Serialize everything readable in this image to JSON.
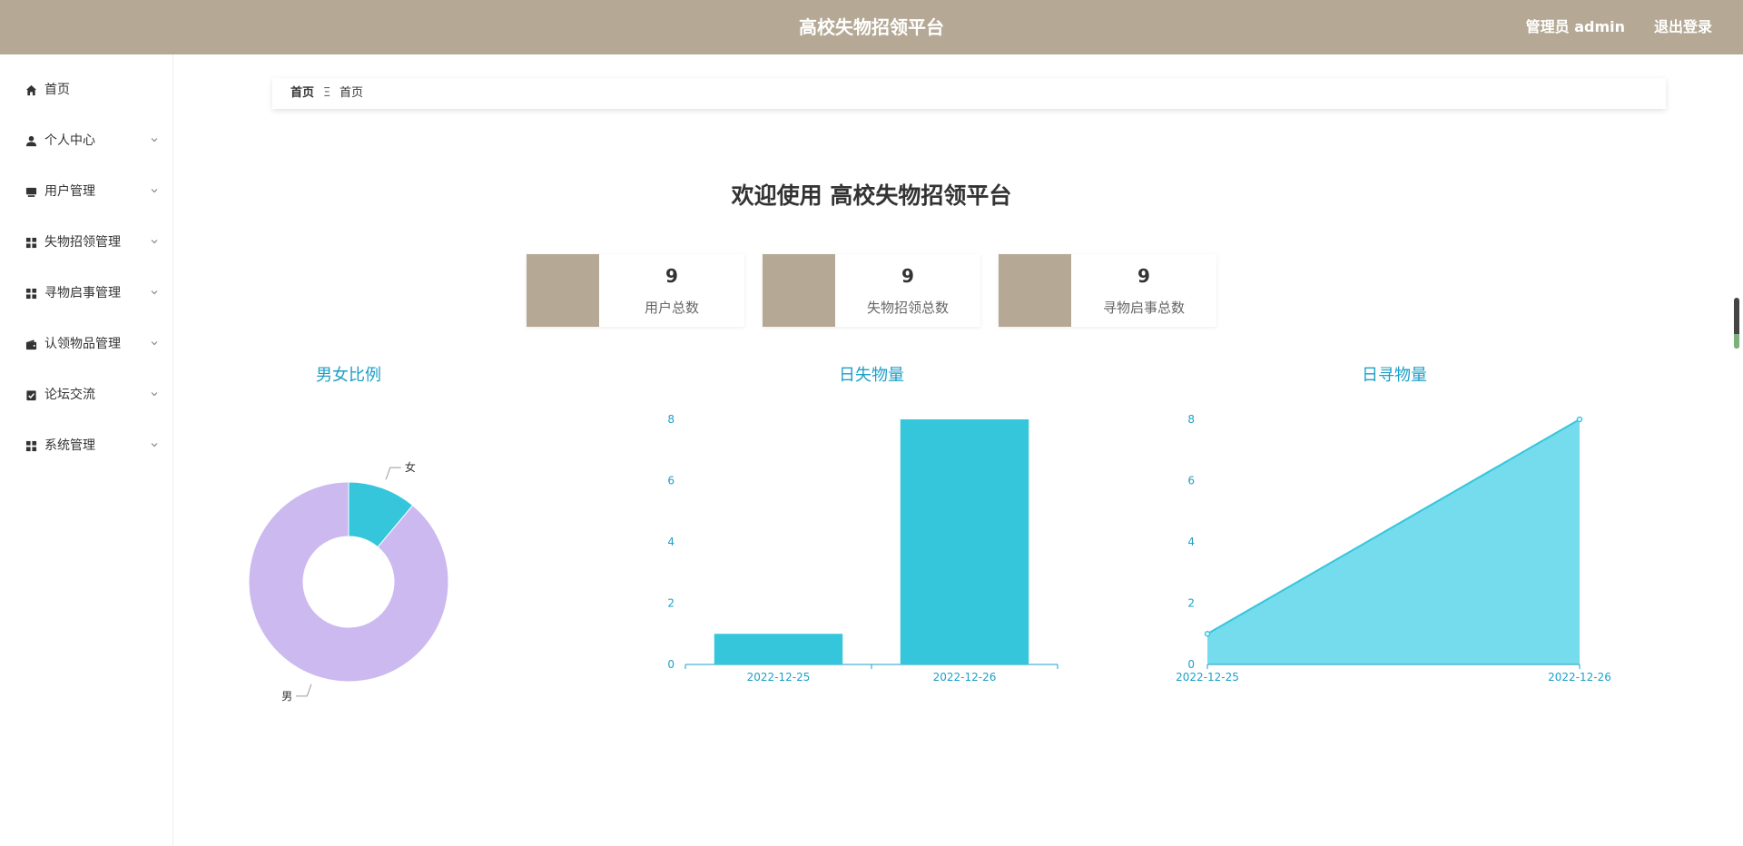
{
  "header": {
    "title": "高校失物招领平台",
    "user": "管理员 admin",
    "logout": "退出登录",
    "bg_color": "#b5a995"
  },
  "sidebar": {
    "items": [
      {
        "label": "首页",
        "icon": "home-icon"
      },
      {
        "label": "个人中心",
        "icon": "user-icon"
      },
      {
        "label": "用户管理",
        "icon": "monitor-icon"
      },
      {
        "label": "失物招领管理",
        "icon": "grid-icon"
      },
      {
        "label": "寻物启事管理",
        "icon": "grid-icon"
      },
      {
        "label": "认领物品管理",
        "icon": "wallet-icon"
      },
      {
        "label": "论坛交流",
        "icon": "clipboard-check-icon"
      },
      {
        "label": "系统管理",
        "icon": "grid-icon"
      }
    ]
  },
  "breadcrumb": {
    "home": "首页",
    "separator": "Ξ",
    "current": "首页"
  },
  "welcome": "欢迎使用 高校失物招领平台",
  "stats": [
    {
      "value": "9",
      "label": "用户总数"
    },
    {
      "value": "9",
      "label": "失物招领总数"
    },
    {
      "value": "9",
      "label": "寻物启事总数"
    }
  ],
  "charts": {
    "gender_title": "男女比例",
    "lost_title": "日失物量",
    "found_title": "日寻物量"
  },
  "chart_data": [
    {
      "type": "pie",
      "title": "男女比例",
      "labels": [
        "女",
        "男"
      ],
      "values": [
        1,
        8
      ],
      "colors": [
        "#36c6dc",
        "#cbb9f0"
      ]
    },
    {
      "type": "bar",
      "title": "日失物量",
      "categories": [
        "2022-12-25",
        "2022-12-26"
      ],
      "values": [
        1,
        8
      ],
      "ylim": [
        0,
        8
      ],
      "yticks": [
        "0",
        "2",
        "4",
        "6",
        "8"
      ],
      "color": "#36c6dc"
    },
    {
      "type": "area",
      "title": "日寻物量",
      "categories": [
        "2022-12-25",
        "2022-12-26"
      ],
      "values": [
        1,
        8
      ],
      "ylim": [
        0,
        8
      ],
      "yticks": [
        "0",
        "2",
        "4",
        "6",
        "8"
      ],
      "color": "#36c6dc"
    }
  ]
}
